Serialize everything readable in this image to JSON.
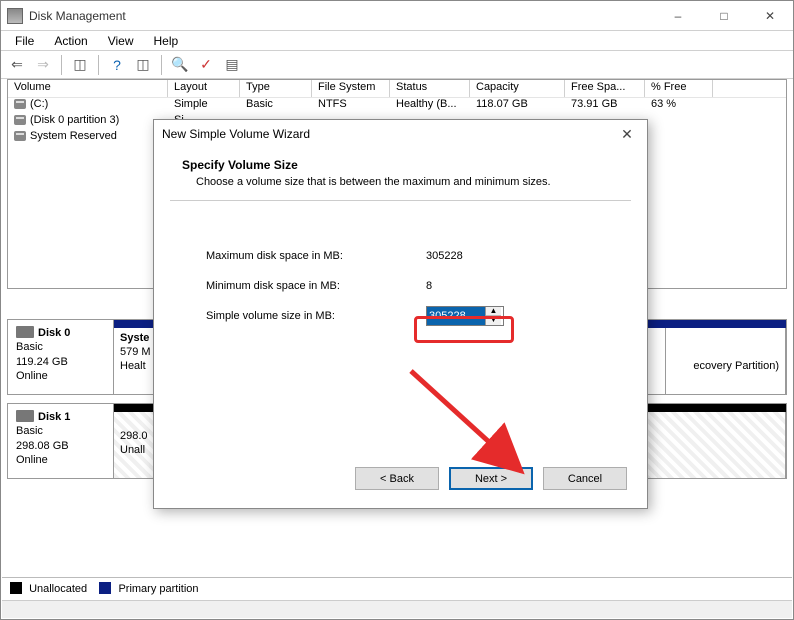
{
  "app": {
    "title": "Disk Management"
  },
  "menu": {
    "file": "File",
    "action": "Action",
    "view": "View",
    "help": "Help"
  },
  "columns": {
    "volume": "Volume",
    "layout": "Layout",
    "type": "Type",
    "fs": "File System",
    "status": "Status",
    "capacity": "Capacity",
    "free": "Free Spa...",
    "pctfree": "% Free"
  },
  "rows": [
    {
      "volume": "(C:)",
      "layout": "Simple",
      "type": "Basic",
      "fs": "NTFS",
      "status": "Healthy (B...",
      "capacity": "118.07 GB",
      "free": "73.91 GB",
      "pctfree": "63 %"
    },
    {
      "volume": "(Disk 0 partition 3)",
      "layout": "Si",
      "type": "",
      "fs": "",
      "status": "",
      "capacity": "",
      "free": "",
      "pctfree": ""
    },
    {
      "volume": "System Reserved",
      "layout": "Si",
      "type": "",
      "fs": "",
      "status": "",
      "capacity": "",
      "free": "",
      "pctfree": ""
    }
  ],
  "disks": [
    {
      "name": "Disk 0",
      "kind": "Basic",
      "size": "119.24 GB",
      "state": "Online",
      "parts": [
        {
          "label1": "Syste",
          "label2": "579 M",
          "label3": "Healt"
        },
        {
          "label1": "",
          "label2": "",
          "label3": ""
        },
        {
          "label1": "",
          "label2": "",
          "label3": "ecovery Partition)"
        }
      ]
    },
    {
      "name": "Disk 1",
      "kind": "Basic",
      "size": "298.08 GB",
      "state": "Online",
      "parts": [
        {
          "label1": "",
          "label2": "298.0",
          "label3": "Unall"
        }
      ]
    }
  ],
  "legend": {
    "unallocated": "Unallocated",
    "primary": "Primary partition"
  },
  "dialog": {
    "title": "New Simple Volume Wizard",
    "heading": "Specify Volume Size",
    "subtitle": "Choose a volume size that is between the maximum and minimum sizes.",
    "max_label": "Maximum disk space in MB:",
    "max_value": "305228",
    "min_label": "Minimum disk space in MB:",
    "min_value": "8",
    "size_label": "Simple volume size in MB:",
    "size_value": "305228",
    "back": "< Back",
    "next": "Next >",
    "cancel": "Cancel"
  }
}
